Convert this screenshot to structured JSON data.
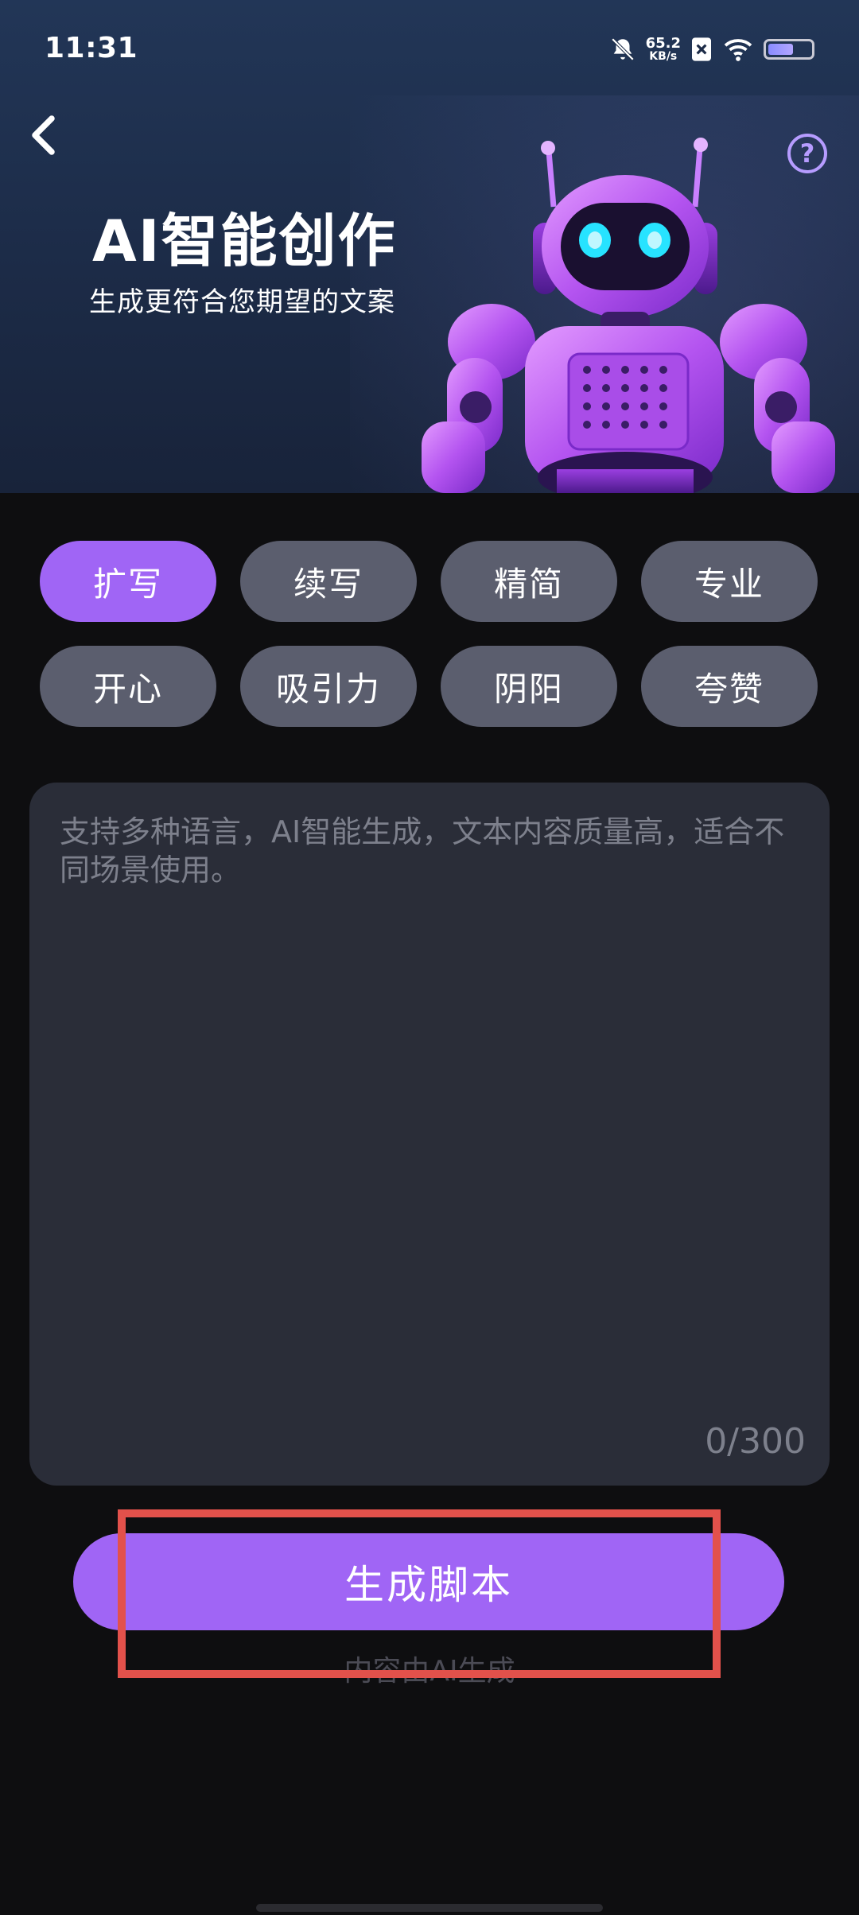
{
  "status_bar": {
    "time": "11:31",
    "net_speed_value": "65.2",
    "net_speed_unit": "KB/s",
    "battery_level": 0.6
  },
  "header": {
    "title": "AI智能创作",
    "subtitle": "生成更符合您期望的文案",
    "help_symbol": "?"
  },
  "chips": [
    {
      "label": "扩写",
      "active": true
    },
    {
      "label": "续写",
      "active": false
    },
    {
      "label": "精简",
      "active": false
    },
    {
      "label": "专业",
      "active": false
    },
    {
      "label": "开心",
      "active": false
    },
    {
      "label": "吸引力",
      "active": false
    },
    {
      "label": "阴阳",
      "active": false
    },
    {
      "label": "夸赞",
      "active": false
    }
  ],
  "input": {
    "placeholder": "支持多种语言，AI智能生成，文本内容质量高，适合不同场景使用。",
    "counter": "0/300"
  },
  "actions": {
    "generate_label": "生成脚本",
    "caption": "内容由AI生成"
  },
  "colors": {
    "accent": "#a065f5",
    "chip_inactive": "#5b5e6e",
    "highlight": "#e2514b"
  }
}
